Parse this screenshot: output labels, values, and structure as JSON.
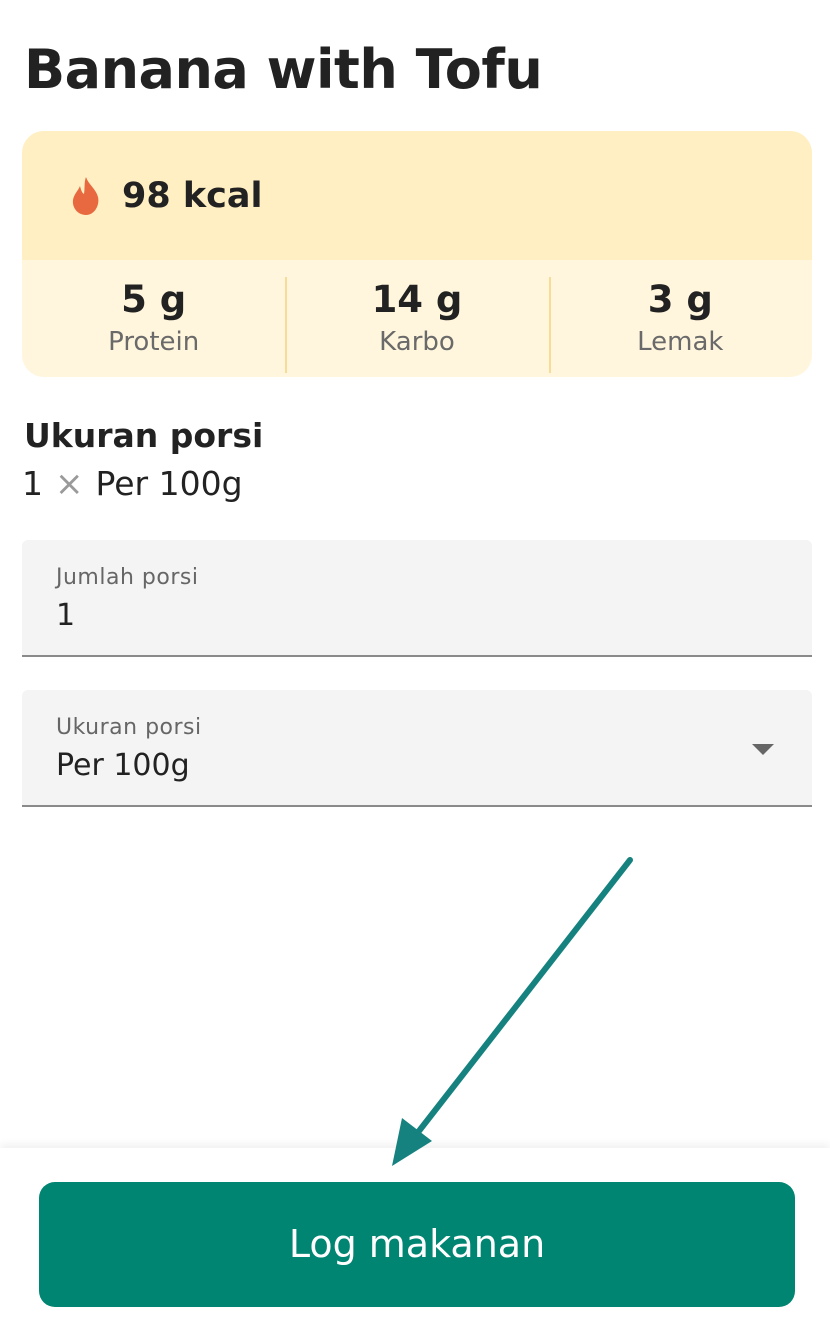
{
  "food": {
    "title": "Banana with Tofu"
  },
  "nutrition": {
    "calories_icon": "flame-icon",
    "calories": "98 kcal",
    "macros": [
      {
        "value": "5 g",
        "label": "Protein"
      },
      {
        "value": "14 g",
        "label": "Karbo"
      },
      {
        "value": "3 g",
        "label": "Lemak"
      }
    ]
  },
  "portion": {
    "heading": "Ukuran porsi",
    "multiplier": "1",
    "times_icon": "×",
    "unit": "Per 100g"
  },
  "form": {
    "servings": {
      "label": "Jumlah porsi",
      "value": "1"
    },
    "serving_size": {
      "label": "Ukuran porsi",
      "value": "Per 100g",
      "icon": "dropdown-arrow-icon"
    }
  },
  "actions": {
    "log_label": "Log makanan"
  },
  "colors": {
    "accent": "#008573",
    "annotation_arrow": "#16827f",
    "flame": "#e8683f",
    "kcal_band": "#ffefc2",
    "macro_band": "#fff6dd"
  }
}
